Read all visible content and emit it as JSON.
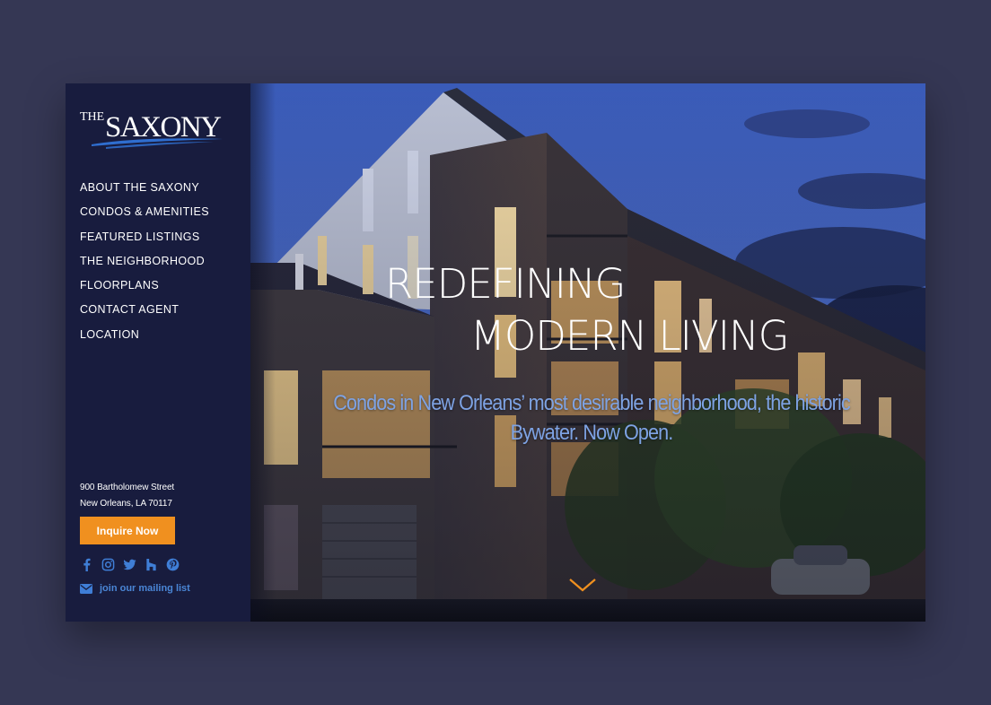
{
  "brand": {
    "logo_the": "THE",
    "logo_name": "SAXONY",
    "accent_color": "#2f6ecf"
  },
  "nav": {
    "items": [
      {
        "label": "ABOUT THE SAXONY"
      },
      {
        "label": "CONDOS & AMENITIES"
      },
      {
        "label": "FEATURED LISTINGS"
      },
      {
        "label": "THE NEIGHBORHOOD"
      },
      {
        "label": "FLOORPLANS"
      },
      {
        "label": "CONTACT AGENT"
      },
      {
        "label": "LOCATION"
      }
    ]
  },
  "contact": {
    "address_line1": "900 Bartholomew Street",
    "address_line2": "New Orleans, LA 70117",
    "inquire_label": "Inquire Now",
    "inquire_color": "#f0901f",
    "mailing_label": "join our mailing list"
  },
  "social": {
    "icons": [
      "facebook-icon",
      "instagram-icon",
      "twitter-icon",
      "houzz-icon",
      "pinterest-icon"
    ],
    "color": "#3f7ed6"
  },
  "hero": {
    "headline_line1": "REDEFINING",
    "headline_line2": "MODERN LIVING",
    "subhead": "Condos in New Orleans’ most desirable neighborhood, the historic Bywater. Now Open.",
    "scroll_color": "#f0901f"
  }
}
